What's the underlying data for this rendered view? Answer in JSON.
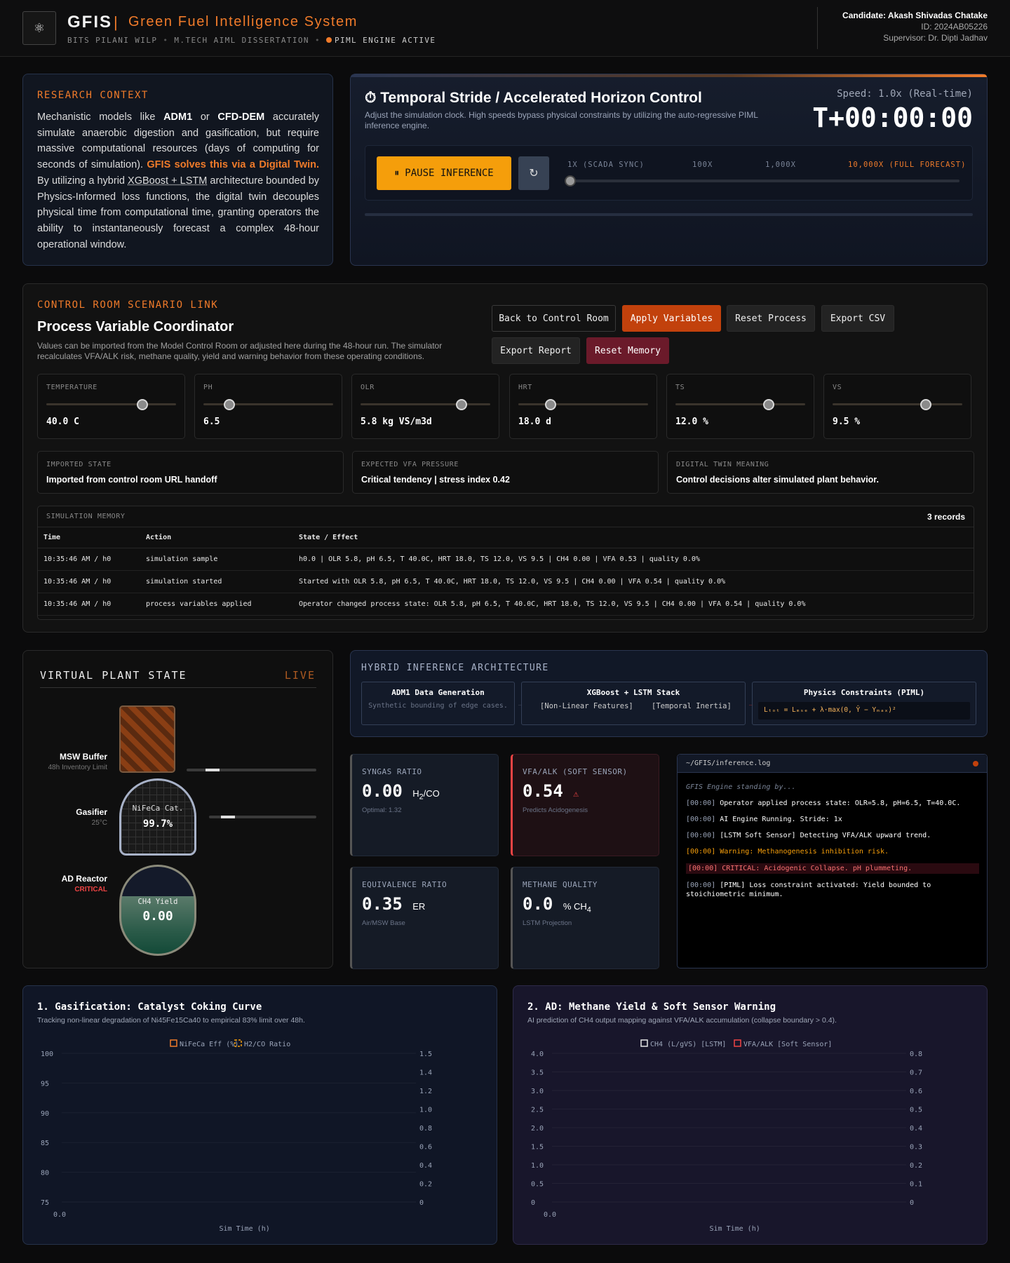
{
  "header": {
    "logo_icon": "atom-icon",
    "brand": "GFIS",
    "separator": "|",
    "brand_sub": "Green Fuel Intelligence System",
    "tag1": "BITS PILANI WILP",
    "tag2": "M.TECH AIML DISSERTATION",
    "tag3": "PIML ENGINE ACTIVE",
    "candidate": "Candidate: Akash Shivadas Chatake",
    "id": "ID: 2024AB05226",
    "supervisor": "Supervisor: Dr. Dipti Jadhav"
  },
  "context": {
    "title": "RESEARCH CONTEXT",
    "p1": "Mechanistic models like ",
    "adm1": "ADM1",
    "p2": " or ",
    "cfd": "CFD-DEM",
    "p3": " accurately simulate anaerobic digestion and gasification, but require massive computational resources (days of computing for seconds of simulation). ",
    "highlight": "GFIS solves this via a Digital Twin.",
    "p4": " By utilizing a hybrid ",
    "arch": "XGBoost + LSTM",
    "p5": " architecture bounded by Physics-Informed loss functions, the digital twin decouples physical time from computational time, granting operators the ability to instantaneously forecast a complex 48-hour operational window."
  },
  "stride": {
    "icon": "stopwatch-icon",
    "title": "Temporal Stride / Accelerated Horizon Control",
    "desc": "Adjust the simulation clock. High speeds bypass physical constraints by utilizing the auto-regressive PIML inference engine.",
    "speed": "Speed: 1.0x (Real-time)",
    "clock": "T+00:00:00",
    "pause_label": "PAUSE INFERENCE",
    "reset_icon": "refresh-icon",
    "ticks": [
      "1X (SCADA SYNC)",
      "100X",
      "1,000X",
      "10,000X (FULL FORECAST)"
    ],
    "slider_fraction": 0
  },
  "coord": {
    "label": "CONTROL ROOM SCENARIO LINK",
    "title": "Process Variable Coordinator",
    "desc": "Values can be imported from the Model Control Room or adjusted here during the 48-hour run. The simulator recalculates VFA/ALK risk, methane quality, yield and warning behavior from these operating conditions.",
    "buttons": {
      "back": "Back to Control Room",
      "apply": "Apply Variables",
      "reset_process": "Reset Process",
      "export_csv": "Export CSV",
      "export_report": "Export Report",
      "reset_memory": "Reset Memory"
    },
    "vars": [
      {
        "name": "TEMPERATURE",
        "value": "40.0 C",
        "fraction": 0.74
      },
      {
        "name": "PH",
        "value": "6.5",
        "fraction": 0.2
      },
      {
        "name": "OLR",
        "value": "5.8 kg VS/m3d",
        "fraction": 0.78
      },
      {
        "name": "HRT",
        "value": "18.0 d",
        "fraction": 0.25
      },
      {
        "name": "TS",
        "value": "12.0 %",
        "fraction": 0.72
      },
      {
        "name": "VS",
        "value": "9.5 %",
        "fraction": 0.72
      }
    ],
    "info": [
      {
        "title": "IMPORTED STATE",
        "value": "Imported from control room URL handoff"
      },
      {
        "title": "EXPECTED VFA PRESSURE",
        "value": "Critical tendency | stress index 0.42"
      },
      {
        "title": "DIGITAL TWIN MEANING",
        "value": "Control decisions alter simulated plant behavior."
      }
    ],
    "memory": {
      "title": "SIMULATION MEMORY",
      "count": "3 records",
      "columns": [
        "Time",
        "Action",
        "State / Effect"
      ],
      "rows": [
        [
          "10:35:46 AM / h0",
          "simulation sample",
          "h0.0 | OLR 5.8, pH 6.5, T 40.0C, HRT 18.0, TS 12.0, VS 9.5 | CH4 0.00 | VFA 0.53 | quality 0.0%"
        ],
        [
          "10:35:46 AM / h0",
          "simulation started",
          "Started with OLR 5.8, pH 6.5, T 40.0C, HRT 18.0, TS 12.0, VS 9.5 | CH4 0.00 | VFA 0.54 | quality 0.0%"
        ],
        [
          "10:35:46 AM / h0",
          "process variables applied",
          "Operator changed process state: OLR 5.8, pH 6.5, T 40.0C, HRT 18.0, TS 12.0, VS 9.5 | CH4 0.00 | VFA 0.54 | quality 0.0%"
        ]
      ]
    }
  },
  "plant": {
    "title": "VIRTUAL PLANT STATE",
    "live": "LIVE",
    "msw": {
      "label": "MSW Buffer",
      "sub": "48h Inventory Limit"
    },
    "gasifier": {
      "label": "Gasifier",
      "sub": "25°C",
      "cat": "NiFeCa Cat.",
      "pct": "99.7%"
    },
    "reactor": {
      "label": "AD Reactor",
      "sub": "CRITICAL",
      "yield_label": "CH4 Yield",
      "yield": "0.00"
    }
  },
  "arch": {
    "title": "HYBRID INFERENCE ARCHITECTURE",
    "b1_title": "ADM1 Data Generation",
    "b1_sub": "Synthetic bounding of edge cases.",
    "b2_title": "XGBoost + LSTM Stack",
    "b2_a": "[Non-Linear Features]",
    "b2_b": "[Temporal Inertia]",
    "b3_title": "Physics Constraints (PIML)",
    "b3_eq": "Lₜₒₜ = Lₘₛₑ + λ·max(0, Ŷ − Yₘₐₓ)²"
  },
  "metrics": {
    "syngas": {
      "title": "SYNGAS RATIO",
      "value": "0.00",
      "unit": "H",
      "unit_sub": "2",
      "unit_tail": "/CO",
      "sub": "Optimal: 1.32"
    },
    "vfa": {
      "title": "VFA/ALK (SOFT SENSOR)",
      "value": "0.54",
      "icon": "warning-icon",
      "sub": "Predicts Acidogenesis"
    },
    "er": {
      "title": "EQUIVALENCE RATIO",
      "value": "0.35",
      "unit": "ER",
      "sub": "Air/MSW Base"
    },
    "ch4": {
      "title": "METHANE QUALITY",
      "value": "0.0",
      "unit": "% CH",
      "unit_sub": "4",
      "sub": "LSTM Projection"
    }
  },
  "log": {
    "path": "~/GFIS/inference.log",
    "standby": "GFIS Engine standing by...",
    "lines": [
      {
        "ts": "[00:00]",
        "msg": "Operator applied process state: OLR=5.8, pH=6.5, T=40.0C."
      },
      {
        "ts": "[00:00]",
        "msg": "AI Engine Running. Stride: 1x"
      },
      {
        "ts": "[00:00]",
        "msg": "[LSTM Soft Sensor] Detecting VFA/ALK upward trend."
      },
      {
        "ts": "[00:00]",
        "msg": "Warning: Methanogenesis inhibition risk."
      },
      {
        "ts": "[00:00]",
        "msg": "CRITICAL: Acidogenic Collapse. pH plummeting."
      },
      {
        "ts": "[00:00]",
        "msg": "[PIML] Loss constraint activated: Yield bounded to stoichiometric minimum."
      }
    ]
  },
  "chart_data": [
    {
      "type": "line",
      "title": "1. Gasification: Catalyst Coking Curve",
      "subtitle": "Tracking non-linear degradation of Ni45Fe15Ca40 to empirical 83% limit over 48h.",
      "xlabel": "Sim Time (h)",
      "x": [
        0.0
      ],
      "x_ticks": [
        "0.0"
      ],
      "series": [
        {
          "name": "NiFeCa Eff (%)",
          "axis": "left",
          "values": [],
          "color": "#f07b2a"
        },
        {
          "name": "H2/CO Ratio",
          "axis": "right",
          "values": [],
          "color": "#f59e0b"
        }
      ],
      "left_ticks": [
        "100",
        "95",
        "90",
        "85",
        "80",
        "75"
      ],
      "right_ticks": [
        "1.5",
        "1.4",
        "1.2",
        "1.0",
        "0.8",
        "0.6",
        "0.4",
        "0.2",
        "0"
      ],
      "ylim_left": [
        75,
        100
      ],
      "ylim_right": [
        0,
        1.5
      ],
      "legend": "top-center"
    },
    {
      "type": "line",
      "title": "2. AD: Methane Yield & Soft Sensor Warning",
      "subtitle": "AI prediction of CH4 output mapping against VFA/ALK accumulation (collapse boundary > 0.4).",
      "xlabel": "Sim Time (h)",
      "x": [
        0.0
      ],
      "x_ticks": [
        "0.0"
      ],
      "series": [
        {
          "name": "CH4 (L/gVS) [LSTM]",
          "axis": "left",
          "values": [],
          "color": "#e6e6e6"
        },
        {
          "name": "VFA/ALK [Soft Sensor]",
          "axis": "right",
          "values": [],
          "color": "#ef4444"
        }
      ],
      "left_ticks": [
        "4.0",
        "3.5",
        "3.0",
        "2.5",
        "2.0",
        "1.5",
        "1.0",
        "0.5",
        "0"
      ],
      "right_ticks": [
        "0.8",
        "0.7",
        "0.6",
        "0.5",
        "0.4",
        "0.3",
        "0.2",
        "0.1",
        "0"
      ],
      "ylim_left": [
        0,
        4
      ],
      "ylim_right": [
        0,
        0.8
      ],
      "legend": "top-center"
    }
  ]
}
